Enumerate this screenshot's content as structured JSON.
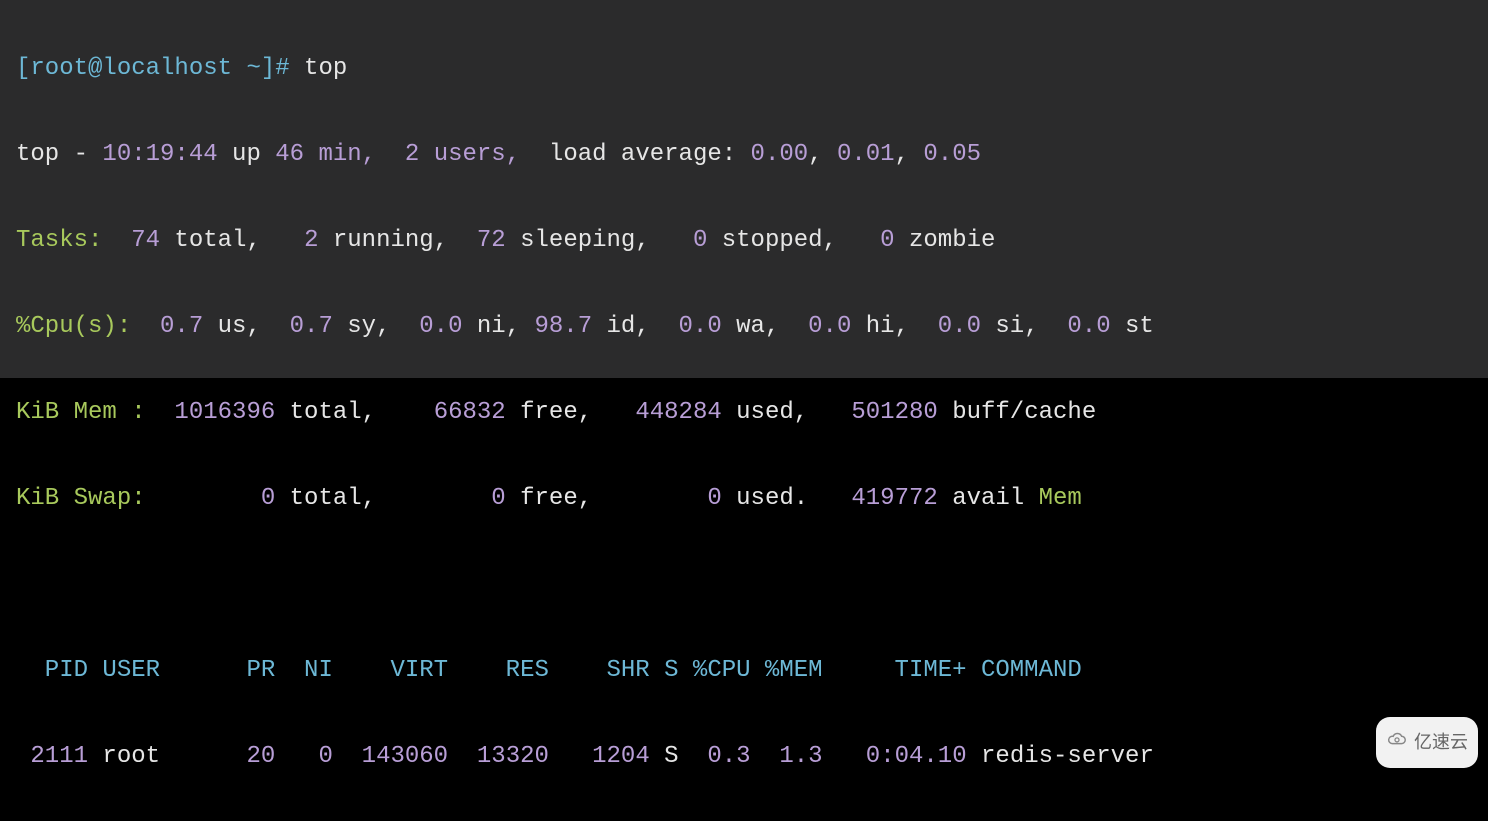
{
  "prompt": {
    "text": "[root@localhost ~]# ",
    "command": "top"
  },
  "top_summary": {
    "prefix": "top - ",
    "time": "10:19:44",
    "up_label": " up ",
    "uptime": "46 min,",
    "users": "  2 users,",
    "load_label": "  load average: ",
    "load1": "0.00",
    "load2": "0.01",
    "load3": "0.05"
  },
  "tasks": {
    "label": "Tasks:",
    "total_n": "  74",
    "total_l": " total,",
    "run_n": "   2",
    "run_l": " running,",
    "sleep_n": "  72",
    "sleep_l": " sleeping,",
    "stop_n": "   0",
    "stop_l": " stopped,",
    "zomb_n": "   0",
    "zomb_l": " zombie"
  },
  "cpu": {
    "label": "%Cpu(s):",
    "us_n": "  0.7",
    "us_l": " us,",
    "sy_n": "  0.7",
    "sy_l": " sy,",
    "ni_n": "  0.0",
    "ni_l": " ni,",
    "id_n": " 98.7",
    "id_l": " id,",
    "wa_n": "  0.0",
    "wa_l": " wa,",
    "hi_n": "  0.0",
    "hi_l": " hi,",
    "si_n": "  0.0",
    "si_l": " si,",
    "st_n": "  0.0",
    "st_l": " st"
  },
  "mem": {
    "label": "KiB Mem :",
    "total_n": "  1016396",
    "total_l": " total,",
    "free_n": "    66832",
    "free_l": " free,",
    "used_n": "   448284",
    "used_l": " used,",
    "buff_n": "   501280",
    "buff_l": " buff/cache"
  },
  "swap": {
    "label": "KiB Swap:",
    "total_n": "        0",
    "total_l": " total,",
    "free_n": "        0",
    "free_l": " free,",
    "used_n": "        0",
    "used_l": " used.",
    "avail_n": "   419772",
    "avail_l": " avail ",
    "avail_m": "Mem"
  },
  "header": "  PID USER      PR  NI    VIRT    RES    SHR S %CPU %MEM     TIME+ COMMAND",
  "proc": {
    "pid": " 2111",
    "user": " root    ",
    "pr": "  20",
    "ni": "   0",
    "virt": "  143060",
    "res": "  13320",
    "shr": "   1204",
    "s": " S",
    "cpu": "  0.3",
    "mem": "  1.3",
    "time": "   0:04.10",
    "cmd": " redis-server"
  },
  "watermark": "亿速云",
  "colors": {
    "bg_term": "#2b2b2c",
    "purple": "#b89ed6",
    "green": "#a8c95c",
    "blue": "#6db8d6",
    "white": "#e6e6e6"
  }
}
